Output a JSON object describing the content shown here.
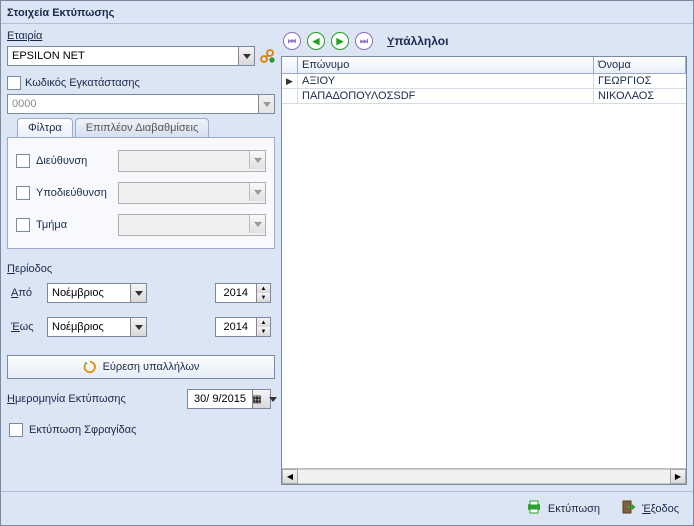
{
  "window_title": "Στοιχεία Εκτύπωσης",
  "company": {
    "label": "Εταιρία",
    "value": "EPSILON NET"
  },
  "install_code": {
    "label": "Κωδικός Εγκατάστασης",
    "value": "0000"
  },
  "tabs": {
    "filters": "Φίλτρα",
    "extra": "Επιπλέον Διαβαθμίσεις"
  },
  "filters": {
    "address": "Διεύθυνση",
    "sub_address": "Υποδιεύθυνση",
    "department": "Τμήμα"
  },
  "period": {
    "label": "Περίοδος",
    "from_label": "Από",
    "to_label": "Έως",
    "from_month": "Νοέμβριος",
    "to_month": "Νοέμβριος",
    "from_year": "2014",
    "to_year": "2014"
  },
  "find_button": "Εύρεση υπαλλήλων",
  "print_date": {
    "label": "Ημερομηνία Εκτύπωσης",
    "value": "30/  9/2015"
  },
  "seal_label": "Εκτύπωση Σφραγίδας",
  "employees": {
    "title": "Υπάλληλοι",
    "columns": {
      "surname": "Επώνυμο",
      "name": "Όνομα"
    },
    "rows": [
      {
        "surname": "ΑΞΙΟΥ",
        "name": "ΓΕΩΡΓΙΟΣ"
      },
      {
        "surname": "ΠΑΠΑΔΟΠΟΥΛΟΣSDF",
        "name": "ΝΙΚΟΛΑΟΣ"
      }
    ]
  },
  "footer": {
    "print": "Εκτύπωση",
    "exit": "Έξοδος"
  }
}
